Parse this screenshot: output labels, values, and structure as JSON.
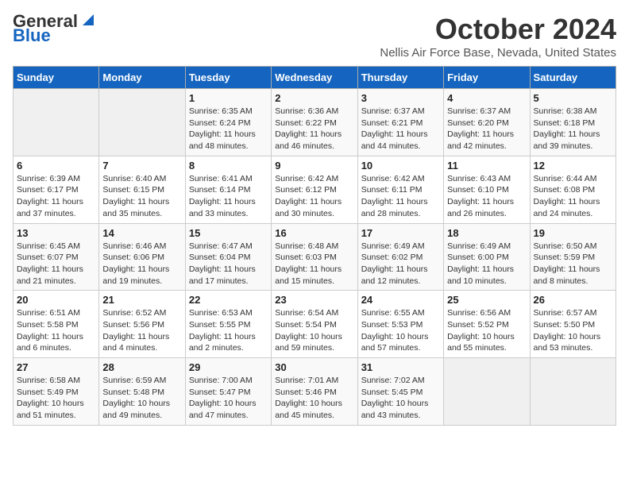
{
  "header": {
    "logo_general": "General",
    "logo_blue": "Blue",
    "title": "October 2024",
    "subtitle": "Nellis Air Force Base, Nevada, United States"
  },
  "weekdays": [
    "Sunday",
    "Monday",
    "Tuesday",
    "Wednesday",
    "Thursday",
    "Friday",
    "Saturday"
  ],
  "weeks": [
    [
      {
        "day": "",
        "info": ""
      },
      {
        "day": "",
        "info": ""
      },
      {
        "day": "1",
        "info": "Sunrise: 6:35 AM\nSunset: 6:24 PM\nDaylight: 11 hours and 48 minutes."
      },
      {
        "day": "2",
        "info": "Sunrise: 6:36 AM\nSunset: 6:22 PM\nDaylight: 11 hours and 46 minutes."
      },
      {
        "day": "3",
        "info": "Sunrise: 6:37 AM\nSunset: 6:21 PM\nDaylight: 11 hours and 44 minutes."
      },
      {
        "day": "4",
        "info": "Sunrise: 6:37 AM\nSunset: 6:20 PM\nDaylight: 11 hours and 42 minutes."
      },
      {
        "day": "5",
        "info": "Sunrise: 6:38 AM\nSunset: 6:18 PM\nDaylight: 11 hours and 39 minutes."
      }
    ],
    [
      {
        "day": "6",
        "info": "Sunrise: 6:39 AM\nSunset: 6:17 PM\nDaylight: 11 hours and 37 minutes."
      },
      {
        "day": "7",
        "info": "Sunrise: 6:40 AM\nSunset: 6:15 PM\nDaylight: 11 hours and 35 minutes."
      },
      {
        "day": "8",
        "info": "Sunrise: 6:41 AM\nSunset: 6:14 PM\nDaylight: 11 hours and 33 minutes."
      },
      {
        "day": "9",
        "info": "Sunrise: 6:42 AM\nSunset: 6:12 PM\nDaylight: 11 hours and 30 minutes."
      },
      {
        "day": "10",
        "info": "Sunrise: 6:42 AM\nSunset: 6:11 PM\nDaylight: 11 hours and 28 minutes."
      },
      {
        "day": "11",
        "info": "Sunrise: 6:43 AM\nSunset: 6:10 PM\nDaylight: 11 hours and 26 minutes."
      },
      {
        "day": "12",
        "info": "Sunrise: 6:44 AM\nSunset: 6:08 PM\nDaylight: 11 hours and 24 minutes."
      }
    ],
    [
      {
        "day": "13",
        "info": "Sunrise: 6:45 AM\nSunset: 6:07 PM\nDaylight: 11 hours and 21 minutes."
      },
      {
        "day": "14",
        "info": "Sunrise: 6:46 AM\nSunset: 6:06 PM\nDaylight: 11 hours and 19 minutes."
      },
      {
        "day": "15",
        "info": "Sunrise: 6:47 AM\nSunset: 6:04 PM\nDaylight: 11 hours and 17 minutes."
      },
      {
        "day": "16",
        "info": "Sunrise: 6:48 AM\nSunset: 6:03 PM\nDaylight: 11 hours and 15 minutes."
      },
      {
        "day": "17",
        "info": "Sunrise: 6:49 AM\nSunset: 6:02 PM\nDaylight: 11 hours and 12 minutes."
      },
      {
        "day": "18",
        "info": "Sunrise: 6:49 AM\nSunset: 6:00 PM\nDaylight: 11 hours and 10 minutes."
      },
      {
        "day": "19",
        "info": "Sunrise: 6:50 AM\nSunset: 5:59 PM\nDaylight: 11 hours and 8 minutes."
      }
    ],
    [
      {
        "day": "20",
        "info": "Sunrise: 6:51 AM\nSunset: 5:58 PM\nDaylight: 11 hours and 6 minutes."
      },
      {
        "day": "21",
        "info": "Sunrise: 6:52 AM\nSunset: 5:56 PM\nDaylight: 11 hours and 4 minutes."
      },
      {
        "day": "22",
        "info": "Sunrise: 6:53 AM\nSunset: 5:55 PM\nDaylight: 11 hours and 2 minutes."
      },
      {
        "day": "23",
        "info": "Sunrise: 6:54 AM\nSunset: 5:54 PM\nDaylight: 10 hours and 59 minutes."
      },
      {
        "day": "24",
        "info": "Sunrise: 6:55 AM\nSunset: 5:53 PM\nDaylight: 10 hours and 57 minutes."
      },
      {
        "day": "25",
        "info": "Sunrise: 6:56 AM\nSunset: 5:52 PM\nDaylight: 10 hours and 55 minutes."
      },
      {
        "day": "26",
        "info": "Sunrise: 6:57 AM\nSunset: 5:50 PM\nDaylight: 10 hours and 53 minutes."
      }
    ],
    [
      {
        "day": "27",
        "info": "Sunrise: 6:58 AM\nSunset: 5:49 PM\nDaylight: 10 hours and 51 minutes."
      },
      {
        "day": "28",
        "info": "Sunrise: 6:59 AM\nSunset: 5:48 PM\nDaylight: 10 hours and 49 minutes."
      },
      {
        "day": "29",
        "info": "Sunrise: 7:00 AM\nSunset: 5:47 PM\nDaylight: 10 hours and 47 minutes."
      },
      {
        "day": "30",
        "info": "Sunrise: 7:01 AM\nSunset: 5:46 PM\nDaylight: 10 hours and 45 minutes."
      },
      {
        "day": "31",
        "info": "Sunrise: 7:02 AM\nSunset: 5:45 PM\nDaylight: 10 hours and 43 minutes."
      },
      {
        "day": "",
        "info": ""
      },
      {
        "day": "",
        "info": ""
      }
    ]
  ]
}
